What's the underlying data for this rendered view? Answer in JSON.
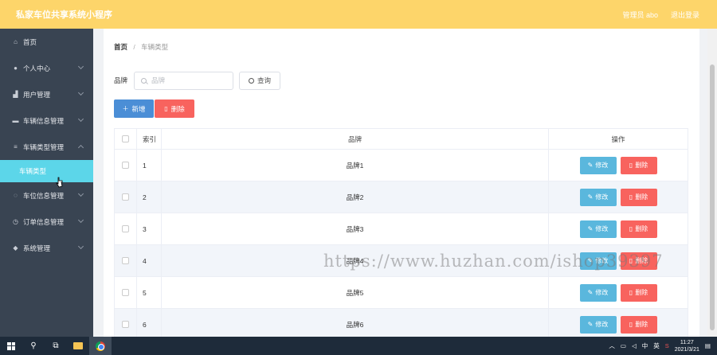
{
  "header": {
    "app_title": "私家车位共享系统小程序",
    "user_label": "管理员 abo",
    "logout_label": "退出登录"
  },
  "sidebar": {
    "items": [
      {
        "label": "首页",
        "icon": "home-icon",
        "glyph": "⌂"
      },
      {
        "label": "个人中心",
        "icon": "user-icon",
        "glyph": "●"
      },
      {
        "label": "用户管理",
        "icon": "users-icon",
        "glyph": "▟"
      },
      {
        "label": "车辆信息管理",
        "icon": "monitor-icon",
        "glyph": "▬"
      },
      {
        "label": "车辆类型管理",
        "icon": "sliders-icon",
        "glyph": "≡"
      },
      {
        "label": "车位信息管理",
        "icon": "power-icon",
        "glyph": "◌"
      },
      {
        "label": "订单信息管理",
        "icon": "clock-icon",
        "glyph": "◷"
      },
      {
        "label": "系统管理",
        "icon": "pin-icon",
        "glyph": "◆"
      }
    ],
    "active_sub": "车辆类型"
  },
  "breadcrumb": {
    "home": "首页",
    "separator": "/",
    "current": "车辆类型"
  },
  "search": {
    "label": "品牌",
    "placeholder": "品牌",
    "query_label": "查询"
  },
  "actions": {
    "add_label": "新增",
    "delete_label": "删除"
  },
  "table": {
    "headers": {
      "index": "索引",
      "brand": "品牌",
      "ops": "操作"
    },
    "rows": [
      {
        "index": "1",
        "brand": "品牌1"
      },
      {
        "index": "2",
        "brand": "品牌2"
      },
      {
        "index": "3",
        "brand": "品牌3"
      },
      {
        "index": "4",
        "brand": "品牌4"
      },
      {
        "index": "5",
        "brand": "品牌5"
      },
      {
        "index": "6",
        "brand": "品牌6"
      }
    ],
    "edit_label": "修改",
    "row_delete_label": "删除"
  },
  "watermark": "https://www.huzhan.com/ishop39397",
  "taskbar": {
    "ime": "中",
    "lang": "英",
    "time": "11:27",
    "date": "2021/3/21"
  },
  "colors": {
    "topbar": "#fdd56a",
    "sidebar": "#394452",
    "active_sub": "#5cd6e9",
    "primary": "#4b8ed6",
    "danger": "#f8635e",
    "edit": "#5ab7dd"
  }
}
